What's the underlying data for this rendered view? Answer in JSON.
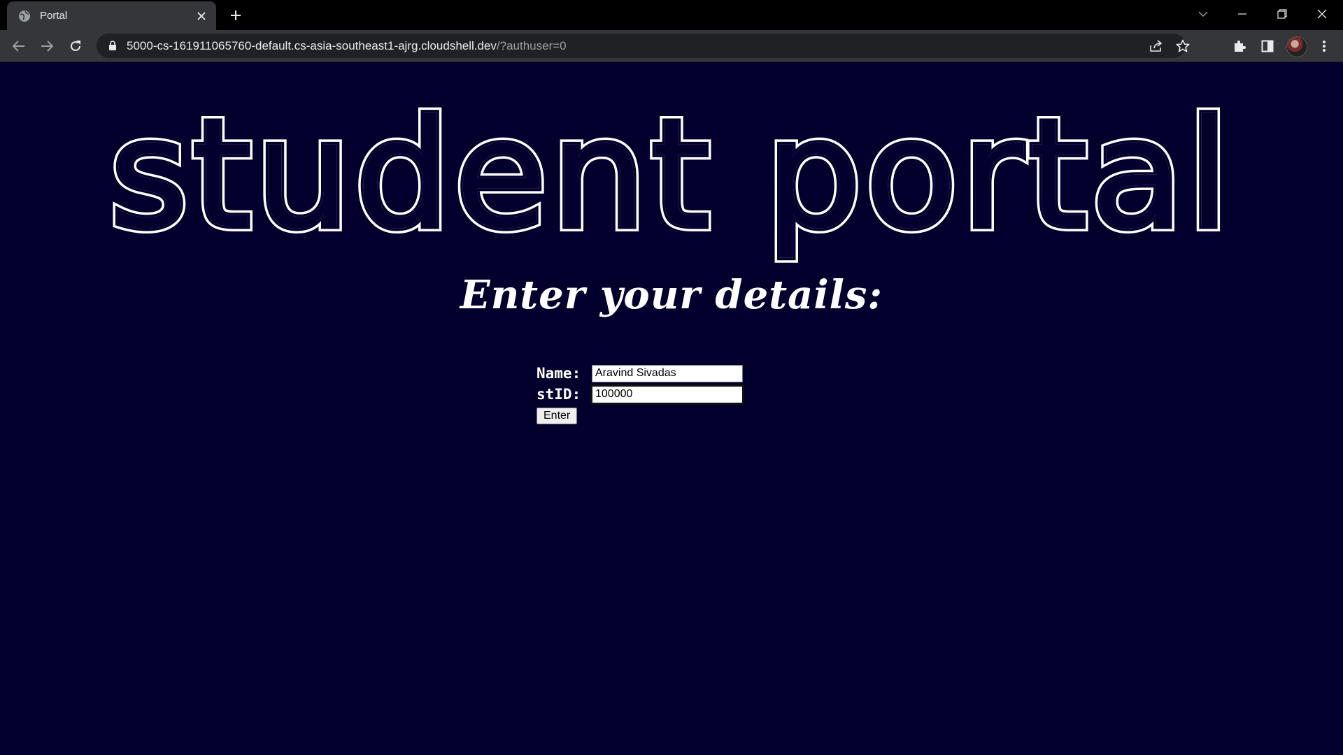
{
  "browser": {
    "tab_title": "Portal",
    "url_main": "5000-cs-161911065760-default.cs-asia-southeast1-ajrg.cloudshell.dev",
    "url_rest": "/?authuser=0",
    "icons": [
      "globe-icon",
      "close-icon",
      "plus-icon",
      "chevron-down-icon",
      "minimize-icon",
      "restore-icon",
      "window-close-icon",
      "back-icon",
      "forward-icon",
      "reload-icon",
      "lock-icon",
      "share-icon",
      "star-icon",
      "extensions-icon",
      "sidepanel-icon",
      "avatar",
      "menu-icon"
    ]
  },
  "page": {
    "title": "student portal",
    "subtitle": "Enter your details:",
    "form": {
      "name_label": "Name:",
      "name_value": "Aravind Sivadas",
      "stid_label": "stID:",
      "stid_value": "100000",
      "submit_label": "Enter"
    },
    "colors": {
      "background": "#03002e",
      "text": "#ffffff"
    }
  }
}
